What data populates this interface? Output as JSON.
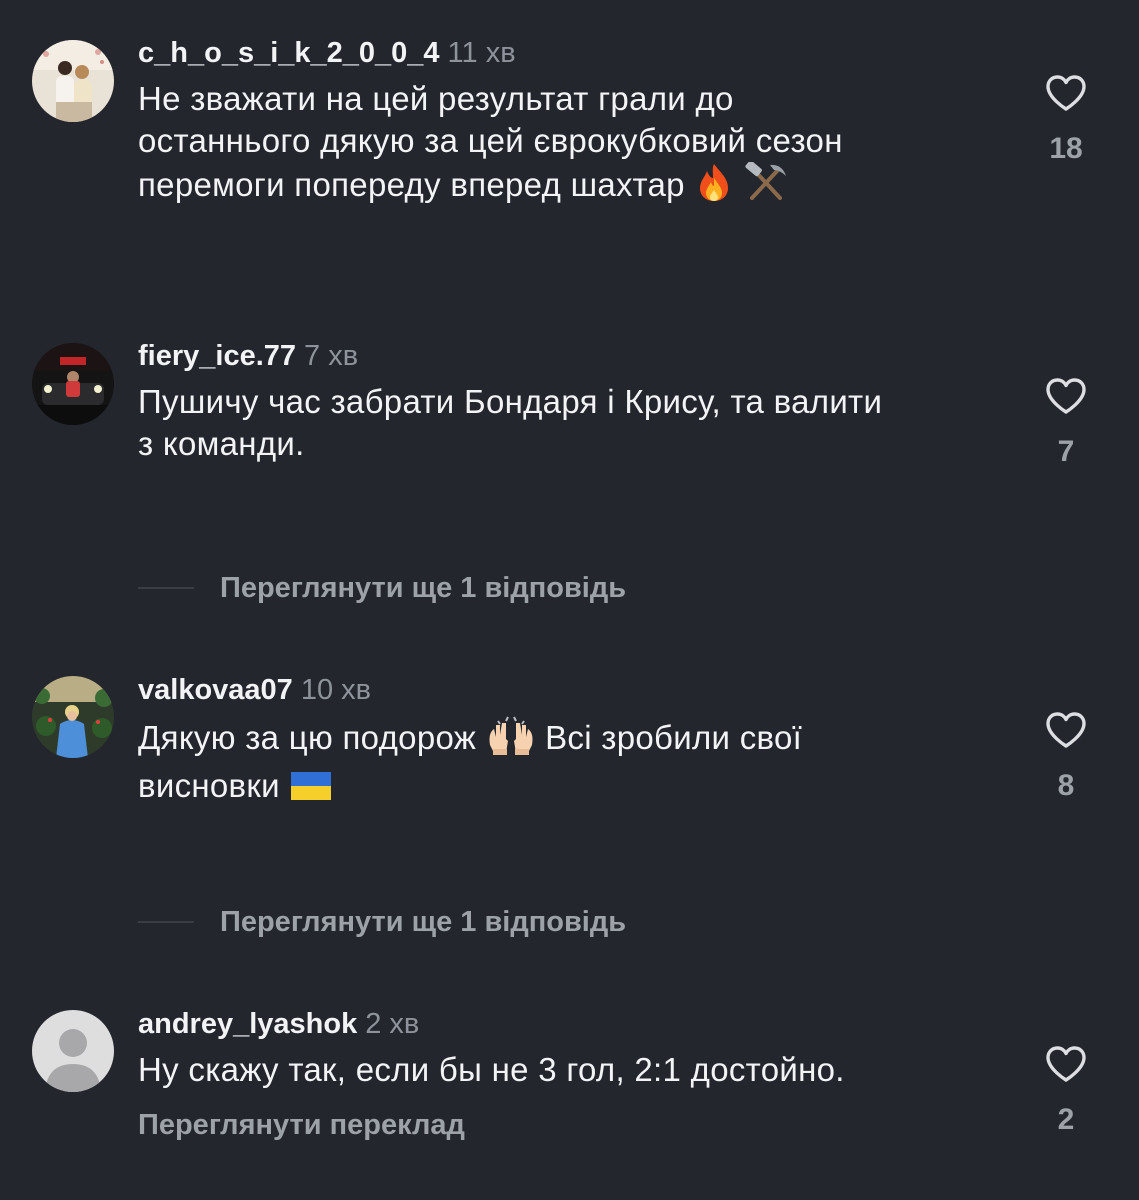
{
  "comments": [
    {
      "username": "c_h_o_s_i_k_2_0_0_4",
      "time": "11 хв",
      "lines": [
        "Не зважати на цей результат грали до",
        "останнього дякую за цей єврокубковий сезон",
        "перемоги попереду вперед шахтар"
      ],
      "emojis": [
        "fire-emoji",
        "hammer-and-pick-emoji"
      ],
      "likes": "18"
    },
    {
      "username": "fiery_ice.77",
      "time": "7 хв",
      "lines": [
        "Пушичу час забрати Бондаря і Крису, та валити",
        "з команди."
      ],
      "likes": "7"
    },
    {
      "username": "valkovaa07",
      "time": "10 хв",
      "line1_before": "Дякую за цю подорож",
      "line1_after": "Всі зробили свої",
      "line2": "висновки",
      "emojis": [
        "raising-hands-emoji",
        "ukraine-flag-emoji"
      ],
      "likes": "8"
    },
    {
      "username": "andrey_lyashok",
      "time": "2 хв",
      "lines": [
        "Ну скажу так, если бы не 3 гол, 2:1 достойно."
      ],
      "translate": "Переглянути переклад",
      "likes": "2"
    }
  ],
  "view_replies": [
    "Переглянути ще 1 відповідь",
    "Переглянути ще 1 відповідь"
  ],
  "colors": {
    "background": "#23262d",
    "text": "#f2f3f5",
    "muted": "#9da1a8",
    "time": "#8e929a"
  },
  "icons": [
    "heart-outline-icon",
    "default-avatar-icon"
  ]
}
